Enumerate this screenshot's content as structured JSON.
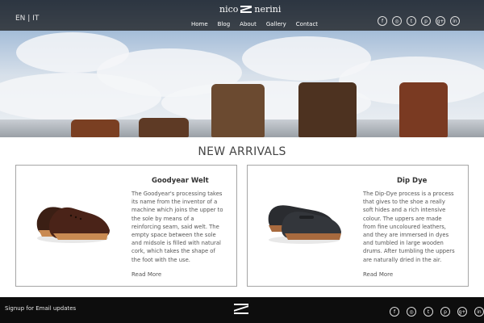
{
  "header": {
    "lang_switch": "EN | IT",
    "logo_left": "nico",
    "logo_right": "nerini",
    "nav": [
      "Home",
      "Blog",
      "About",
      "Gallery",
      "Contact"
    ],
    "social_icons": [
      "facebook-icon",
      "instagram-icon",
      "twitter-icon",
      "pinterest-icon",
      "google-plus-icon",
      "linkedin-icon"
    ],
    "social_glyphs": [
      "f",
      "◎",
      "t",
      "p",
      "g+",
      "in"
    ]
  },
  "main": {
    "section_title": "NEW ARRIVALS",
    "products": [
      {
        "title": "Goodyear Welt",
        "description": "The Goodyear's processing takes its name from the inventor of a machine which joins the upper to the sole by means of a reinforcing seam, said welt. The empty space between the sole and midsole is filled with natural cork, which takes the shape of the foot with the use.",
        "link": "Read More"
      },
      {
        "title": "Dip Dye",
        "description": "The Dip-Dye process is a process that gives to the shoe a really soft hides and a rich intensive colour. The uppers are made from fine uncoloured leathers, and they are immersed in dyes and tumbled in large wooden drums. After tumbling the uppers are naturally dried in the air.",
        "link": "Read More"
      }
    ]
  },
  "footer": {
    "signup": "Signup for Email updates"
  },
  "colors": {
    "topbar": "#141414",
    "footer": "#0d0d0d",
    "card_border": "#a6a6a6"
  }
}
